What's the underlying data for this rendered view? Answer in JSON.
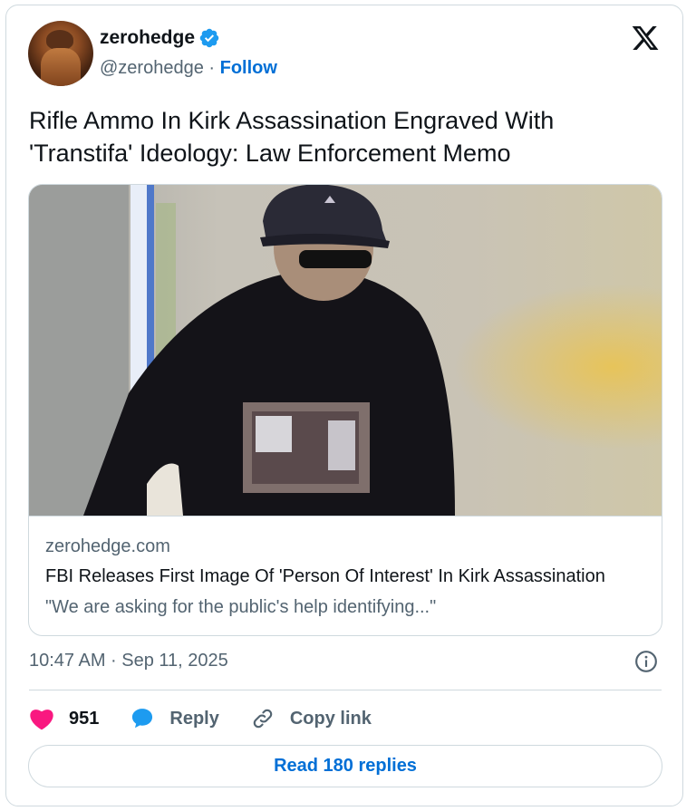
{
  "author": {
    "name": "zerohedge",
    "handle": "@zerohedge",
    "separator": "·",
    "follow_label": "Follow",
    "verified_icon": "verified-badge-icon"
  },
  "platform_icon": "x-logo-icon",
  "tweet_text": "Rifle Ammo In Kirk Assassination Engraved With 'Transtifa' Ideology: Law Enforcement Memo",
  "link_card": {
    "domain": "zerohedge.com",
    "title": "FBI Releases First Image Of 'Person Of Interest' In Kirk Assassination",
    "description": "\"We are asking for the public's help identifying...\""
  },
  "timestamp": "10:47 AM · Sep 11, 2025",
  "actions": {
    "like_count": "951",
    "reply_label": "Reply",
    "copy_label": "Copy link"
  },
  "read_replies_label": "Read 180 replies",
  "colors": {
    "accent": "#006fd6",
    "verified": "#1d9bf0",
    "like": "#f91880",
    "muted": "#536471",
    "border": "#cfd9de"
  }
}
